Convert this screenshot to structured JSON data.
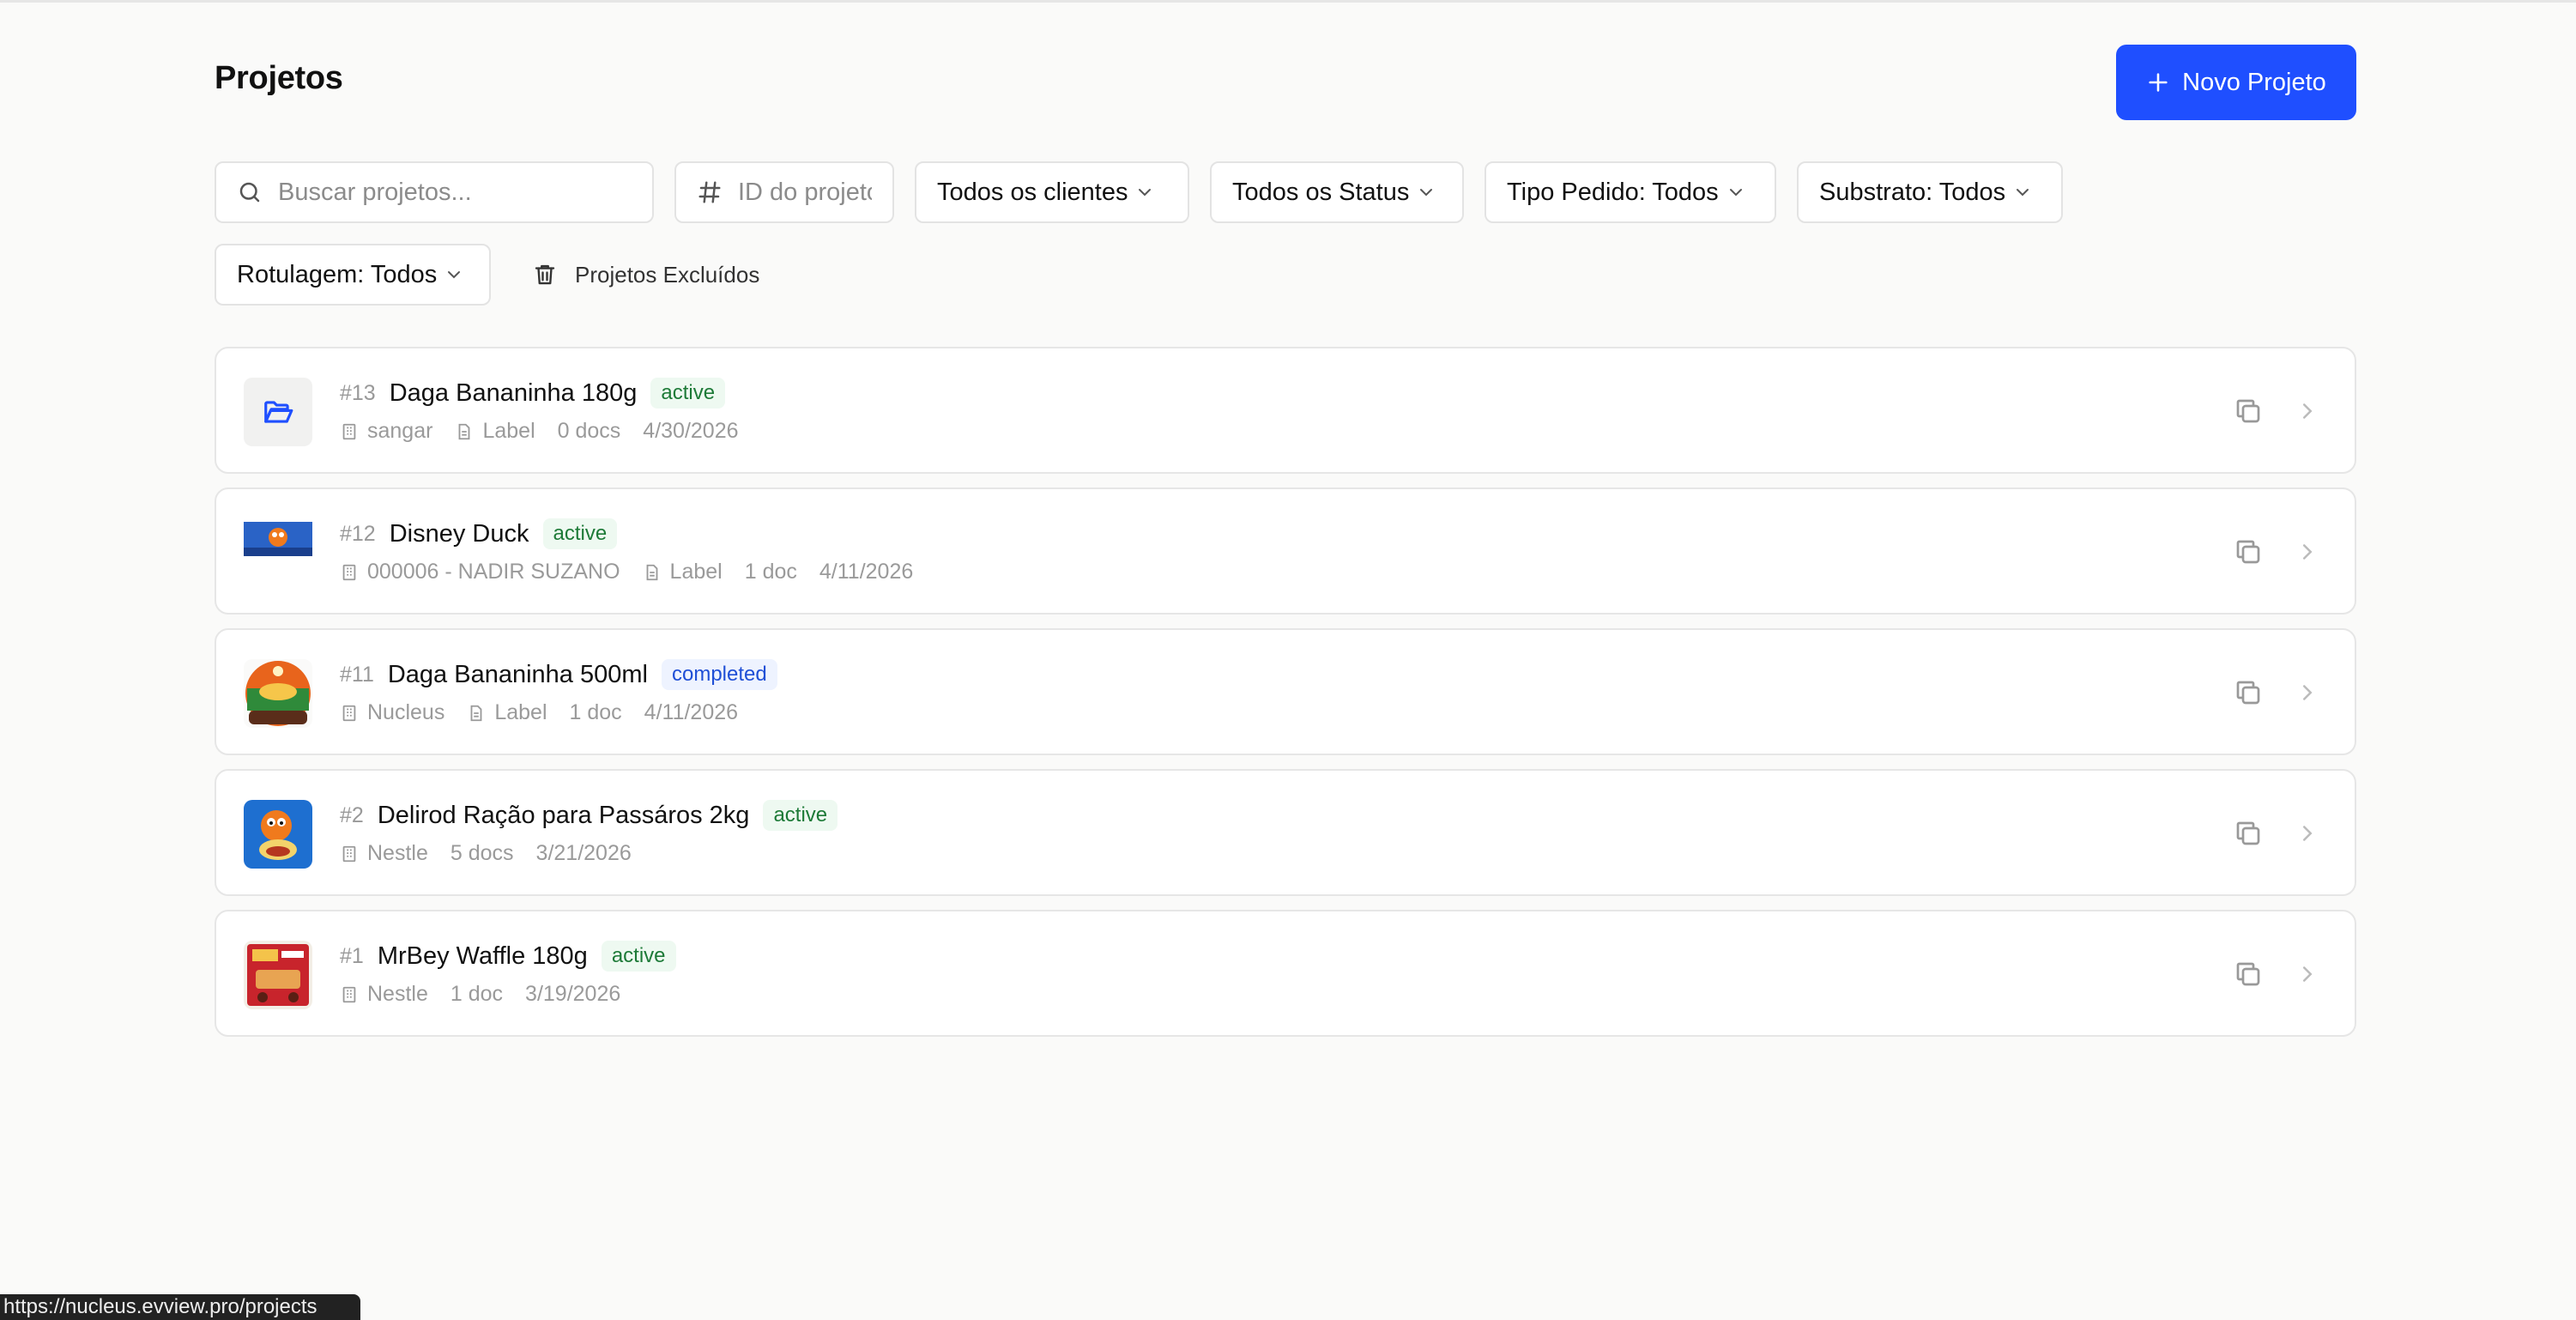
{
  "page": {
    "title": "Projetos"
  },
  "actions": {
    "new_project": "Novo Projeto",
    "deleted_projects": "Projetos Excluídos"
  },
  "filters": {
    "search_placeholder": "Buscar projetos...",
    "id_placeholder": "ID do projeto",
    "clients": "Todos os clientes",
    "status": "Todos os Status",
    "tipo": "Tipo Pedido: Todos",
    "substrato": "Substrato: Todos",
    "rotulagem": "Rotulagem: Todos"
  },
  "projects": [
    {
      "id": "#13",
      "name": "Daga Bananinha 180g",
      "status": "active",
      "client": "sangar",
      "type": "Label",
      "docs": "0 docs",
      "date": "4/30/2026",
      "thumb": "folder-icon"
    },
    {
      "id": "#12",
      "name": "Disney Duck",
      "status": "active",
      "client": "000006 - NADIR SUZANO",
      "type": "Label",
      "docs": "1 doc",
      "date": "4/11/2026",
      "thumb": "image"
    },
    {
      "id": "#11",
      "name": "Daga Bananinha 500ml",
      "status": "completed",
      "client": "Nucleus",
      "type": "Label",
      "docs": "1 doc",
      "date": "4/11/2026",
      "thumb": "image"
    },
    {
      "id": "#2",
      "name": "Delirod Ração para Passáros 2kg",
      "status": "active",
      "client": "Nestle",
      "docs": "5 docs",
      "date": "3/21/2026",
      "thumb": "image"
    },
    {
      "id": "#1",
      "name": "MrBey Waffle 180g",
      "status": "active",
      "client": "Nestle",
      "docs": "1 doc",
      "date": "3/19/2026",
      "thumb": "image"
    }
  ],
  "statusbar": {
    "url": "https://nucleus.evview.pro/projects"
  },
  "colors": {
    "accent": "#1f4fff",
    "active_text": "#1d7a37",
    "completed_text": "#1f4fd6"
  }
}
